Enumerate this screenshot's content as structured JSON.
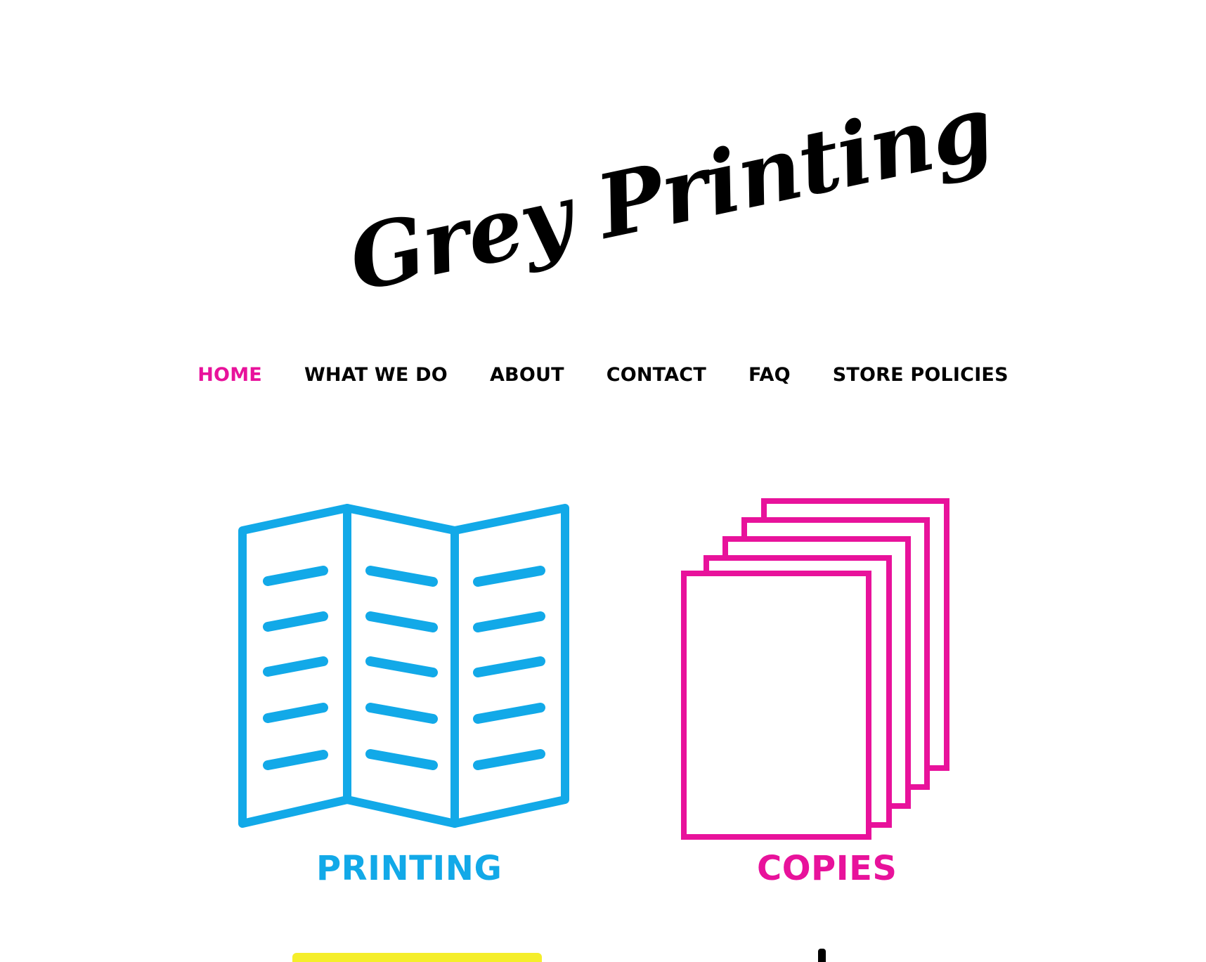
{
  "brand": {
    "logo_text": "Grey Printing"
  },
  "nav": {
    "items": [
      {
        "label": "HOME",
        "active": true
      },
      {
        "label": "WHAT WE DO",
        "active": false
      },
      {
        "label": "ABOUT",
        "active": false
      },
      {
        "label": "CONTACT",
        "active": false
      },
      {
        "label": "FAQ",
        "active": false
      },
      {
        "label": "STORE POLICIES",
        "active": false
      }
    ]
  },
  "services": {
    "printing": {
      "label": "PRINTING",
      "icon": "brochure-icon",
      "color": "#12a9e8"
    },
    "copies": {
      "label": "COPIES",
      "icon": "paper-stack-icon",
      "color": "#e8129b"
    }
  },
  "colors": {
    "accent_pink": "#e8129b",
    "accent_cyan": "#12a9e8",
    "accent_yellow": "#f5ee2b",
    "text": "#000000"
  }
}
